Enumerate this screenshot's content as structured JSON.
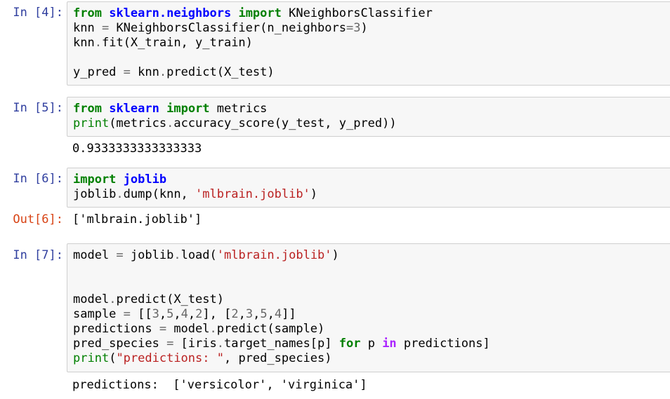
{
  "cells": [
    {
      "prompt": "In [4]:",
      "lines": [
        [
          {
            "t": "from",
            "c": "kw"
          },
          {
            "t": " "
          },
          {
            "t": "sklearn.neighbors",
            "c": "mod"
          },
          {
            "t": " "
          },
          {
            "t": "import",
            "c": "kw"
          },
          {
            "t": " KNeighborsClassifier"
          }
        ],
        [
          {
            "t": "knn "
          },
          {
            "t": "=",
            "c": "op"
          },
          {
            "t": " KNeighborsClassifier(n_neighbors"
          },
          {
            "t": "=",
            "c": "op"
          },
          {
            "t": "3",
            "c": "num"
          },
          {
            "t": ")"
          }
        ],
        [
          {
            "t": "knn"
          },
          {
            "t": ".",
            "c": "op"
          },
          {
            "t": "fit(X_train, y_train)"
          }
        ],
        [
          {
            "t": ""
          }
        ],
        [
          {
            "t": "y_pred "
          },
          {
            "t": "=",
            "c": "op"
          },
          {
            "t": " knn"
          },
          {
            "t": ".",
            "c": "op"
          },
          {
            "t": "predict(X_test)"
          }
        ]
      ],
      "output": null
    },
    {
      "prompt": "In [5]:",
      "lines": [
        [
          {
            "t": "from",
            "c": "kw"
          },
          {
            "t": " "
          },
          {
            "t": "sklearn",
            "c": "mod"
          },
          {
            "t": " "
          },
          {
            "t": "import",
            "c": "kw"
          },
          {
            "t": " metrics"
          }
        ],
        [
          {
            "t": "print",
            "c": "bi"
          },
          {
            "t": "(metrics"
          },
          {
            "t": ".",
            "c": "op"
          },
          {
            "t": "accuracy_score(y_test, y_pred))"
          }
        ]
      ],
      "output": {
        "prompt": "",
        "text": "0.9333333333333333"
      }
    },
    {
      "prompt": "In [6]:",
      "lines": [
        [
          {
            "t": "import",
            "c": "kw"
          },
          {
            "t": " "
          },
          {
            "t": "joblib",
            "c": "mod"
          }
        ],
        [
          {
            "t": "joblib"
          },
          {
            "t": ".",
            "c": "op"
          },
          {
            "t": "dump(knn, "
          },
          {
            "t": "'mlbrain.joblib'",
            "c": "str"
          },
          {
            "t": ")"
          }
        ]
      ],
      "output": {
        "prompt": "Out[6]:",
        "text": "['mlbrain.joblib']"
      }
    },
    {
      "prompt": "In [7]:",
      "lines": [
        [
          {
            "t": "model "
          },
          {
            "t": "=",
            "c": "op"
          },
          {
            "t": " joblib"
          },
          {
            "t": ".",
            "c": "op"
          },
          {
            "t": "load("
          },
          {
            "t": "'mlbrain.joblib'",
            "c": "str"
          },
          {
            "t": ")"
          }
        ],
        [
          {
            "t": ""
          }
        ],
        [
          {
            "t": ""
          }
        ],
        [
          {
            "t": "model"
          },
          {
            "t": ".",
            "c": "op"
          },
          {
            "t": "predict(X_test)"
          }
        ],
        [
          {
            "t": "sample "
          },
          {
            "t": "=",
            "c": "op"
          },
          {
            "t": " [["
          },
          {
            "t": "3",
            "c": "num"
          },
          {
            "t": ","
          },
          {
            "t": "5",
            "c": "num"
          },
          {
            "t": ","
          },
          {
            "t": "4",
            "c": "num"
          },
          {
            "t": ","
          },
          {
            "t": "2",
            "c": "num"
          },
          {
            "t": "], ["
          },
          {
            "t": "2",
            "c": "num"
          },
          {
            "t": ","
          },
          {
            "t": "3",
            "c": "num"
          },
          {
            "t": ","
          },
          {
            "t": "5",
            "c": "num"
          },
          {
            "t": ","
          },
          {
            "t": "4",
            "c": "num"
          },
          {
            "t": "]]"
          }
        ],
        [
          {
            "t": "predictions "
          },
          {
            "t": "=",
            "c": "op"
          },
          {
            "t": " model"
          },
          {
            "t": ".",
            "c": "op"
          },
          {
            "t": "predict(sample)"
          }
        ],
        [
          {
            "t": "pred_species "
          },
          {
            "t": "=",
            "c": "op"
          },
          {
            "t": " [iris"
          },
          {
            "t": ".",
            "c": "op"
          },
          {
            "t": "target_names[p] "
          },
          {
            "t": "for",
            "c": "kw"
          },
          {
            "t": " p "
          },
          {
            "t": "in",
            "c": "kw2"
          },
          {
            "t": " predictions]"
          }
        ],
        [
          {
            "t": "print",
            "c": "bi"
          },
          {
            "t": "("
          },
          {
            "t": "\"predictions: \"",
            "c": "str"
          },
          {
            "t": ", pred_species)"
          }
        ]
      ],
      "output": {
        "prompt": "",
        "text": "predictions:  ['versicolor', 'virginica']"
      }
    }
  ]
}
